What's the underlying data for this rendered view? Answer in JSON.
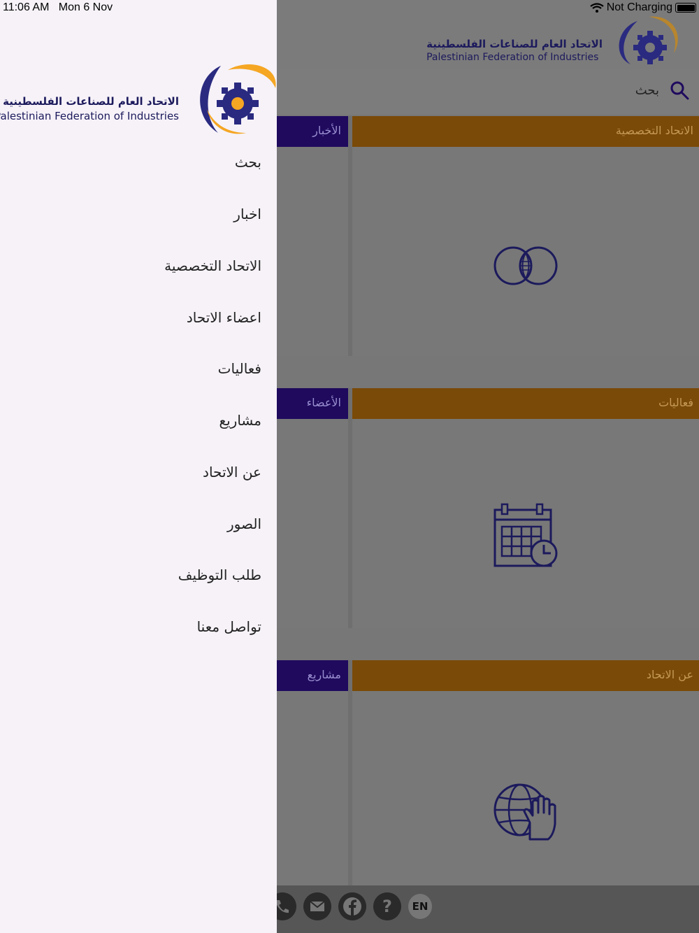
{
  "status_bar": {
    "time": "11:06 AM",
    "date": "Mon 6 Nov",
    "charging": "Not Charging"
  },
  "brand": {
    "name_ar": "الاتحاد العام للصناعات الفلسطينية",
    "name_en": "Palestinian Federation of Industries",
    "colors": {
      "primary": "#2a2a80",
      "accent": "#f5a623"
    }
  },
  "search": {
    "label": "بحث",
    "icon": "search-icon"
  },
  "tiles": [
    {
      "left_label": "الأخبار",
      "right_label": "الاتحاد التخصصية",
      "icon": "venn-circles-icon"
    },
    {
      "left_label": "الأعضاء",
      "right_label": "فعاليات",
      "icon": "calendar-clock-icon"
    },
    {
      "left_label": "مشاريع",
      "right_label": "عن الاتحاد",
      "icon": "globe-hand-icon"
    }
  ],
  "footer": {
    "lang": "EN",
    "icons": [
      "phone-icon",
      "mail-icon",
      "facebook-icon",
      "help-icon"
    ]
  },
  "drawer": {
    "menu": [
      "بحث",
      "اخبار",
      "الاتحاد التخصصية",
      "اعضاء الاتحاد",
      "فعاليات",
      "مشاريع",
      "عن الاتحاد",
      "الصور",
      "طلب التوظيف",
      "تواصل معنا"
    ]
  }
}
